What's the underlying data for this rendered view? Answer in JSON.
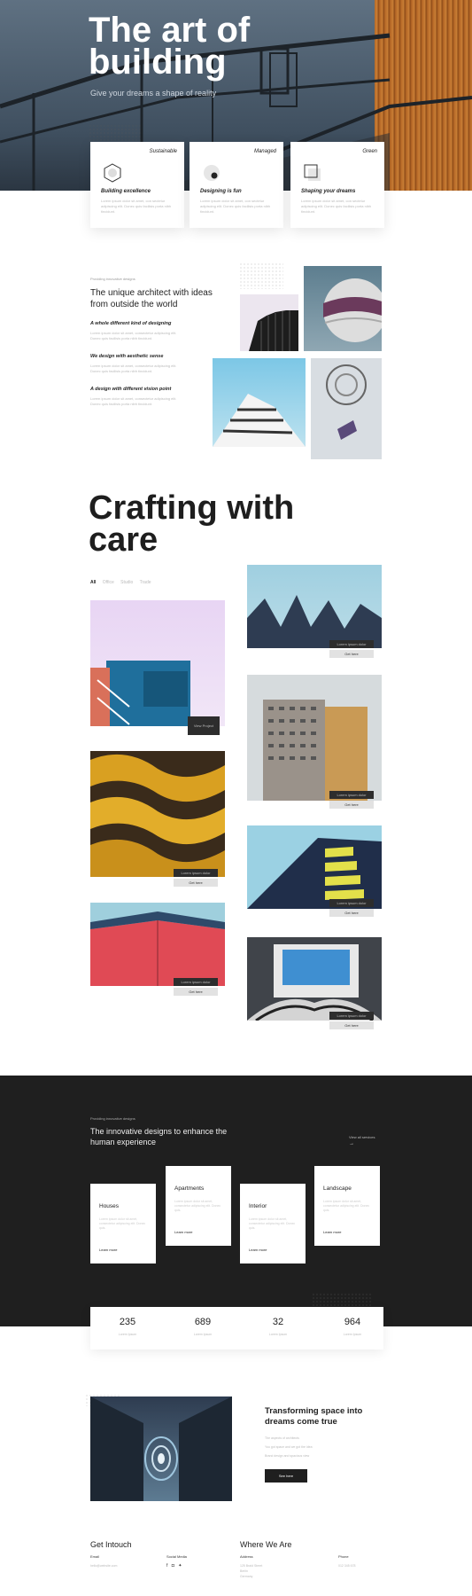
{
  "hero": {
    "title": "The art of building",
    "subtitle": "Give your dreams a shape of reality"
  },
  "features": [
    {
      "tag": "Sustainable",
      "title": "Building excellence",
      "desc": "Lorem ipsum dolor sit amet, con sectetur adipiscing elit. Donec quis facilisis porta nibh tincidunt."
    },
    {
      "tag": "Managed",
      "title": "Designing is fun",
      "desc": "Lorem ipsum dolor sit amet, con sectetur adipiscing elit. Donec quis facilisis porta nibh tincidunt."
    },
    {
      "tag": "Green",
      "title": "Shaping your dreams",
      "desc": "Lorem ipsum dolor sit amet, con sectetur adipiscing elit. Donec quis facilisis porta nibh tincidunt."
    }
  ],
  "about": {
    "kicker": "Providing innovative designs",
    "heading": "The unique architect with ideas from outside the world",
    "items": [
      {
        "title": "A whole different kind of designing",
        "desc": "Lorem ipsum dolor sit amet, consectetur adipiscing elit. Donec quis facilisis porta nibh tincidunt."
      },
      {
        "title": "We design with aesthetic sense",
        "desc": "Lorem ipsum dolor sit amet, consectetur adipiscing elit. Donec quis facilisis porta nibh tincidunt."
      },
      {
        "title": "A design with different vision point",
        "desc": "Lorem ipsum dolor sit amet, consectetur adipiscing elit. Donec quis facilisis porta nibh tincidunt."
      }
    ]
  },
  "crafting": {
    "title": "Crafting with care",
    "filters": [
      "All",
      "Office",
      "Studio",
      "Trade"
    ],
    "projects": {
      "p1": {
        "label": "View Project"
      },
      "p2": {
        "label": "Lorem ipsum dolor",
        "button": "Get here"
      },
      "p3": {
        "label": "Lorem ipsum dolor",
        "button": "Get here"
      },
      "p4": {
        "label": "Lorem ipsum dolor",
        "button": "Get here"
      },
      "p5": {
        "label": "Lorem ipsum dolor",
        "button": "Get here"
      },
      "p6": {
        "label": "Lorem ipsum dolor",
        "button": "Get here"
      },
      "p7": {
        "label": "Lorem ipsum dolor",
        "button": "Get here"
      }
    }
  },
  "services": {
    "kicker": "Providing innovative designs",
    "heading": "The innovative designs to enhance the human experience",
    "view_all": "View all services",
    "items": [
      {
        "title": "Houses",
        "desc": "Lorem ipsum dolor sit amet, consectetur adipiscing elit. Donec quis.",
        "link": "Learn more"
      },
      {
        "title": "Apartments",
        "desc": "Lorem ipsum dolor sit amet, consectetur adipiscing elit. Donec quis.",
        "link": "Learn more"
      },
      {
        "title": "Interior",
        "desc": "Lorem ipsum dolor sit amet, consectetur adipiscing elit. Donec quis.",
        "link": "Learn more"
      },
      {
        "title": "Landscape",
        "desc": "Lorem ipsum dolor sit amet, consectetur adipiscing elit. Donec quis.",
        "link": "Learn more"
      }
    ]
  },
  "stats": [
    {
      "value": "235",
      "label": "Lorem Ipsum"
    },
    {
      "value": "689",
      "label": "Lorem Ipsum"
    },
    {
      "value": "32",
      "label": "Lorem Ipsum"
    },
    {
      "value": "964",
      "label": "Lorem Ipsum"
    }
  ],
  "transform": {
    "heading": "Transforming space into dreams come true",
    "lines": [
      "The aspects of architects",
      "You got space and we got the idea",
      "Brand design and spacious view"
    ],
    "button": "See here"
  },
  "footer": {
    "intouch": "Get Intouch",
    "email_label": "Email",
    "email_value": "hello@website.com",
    "social_label": "Social Media",
    "where": "Where We Are",
    "address_label": "Address",
    "address_lines": [
      "125 Braid Street",
      "Berlin",
      "Germany"
    ],
    "phone_label": "Phone",
    "phone_value": "012 345 678"
  },
  "colors": {
    "dark": "#1f1f1f",
    "accent_orange": "#c97f36",
    "sky": "#9fcfe0"
  }
}
